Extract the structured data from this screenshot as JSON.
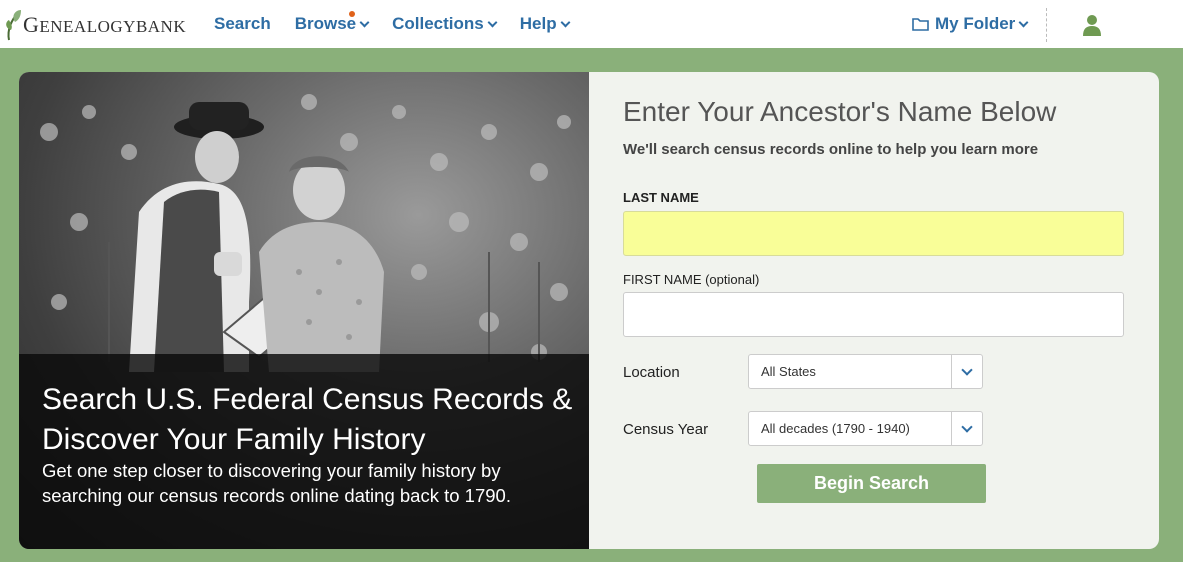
{
  "header": {
    "logo_text_initial": "G",
    "logo_text_rest": "ENEALOGY",
    "logo_text_bank": "BANK",
    "nav": [
      {
        "label": "Search"
      },
      {
        "label": "Browse"
      },
      {
        "label": "Collections"
      },
      {
        "label": "Help"
      }
    ],
    "folder_label": "My Folder"
  },
  "hero": {
    "title": "Search U.S. Federal Census Records & Discover Your Family History",
    "subtitle": "Get one step closer to discovering your family history by searching our census records online dating back to 1790."
  },
  "form": {
    "title": "Enter Your Ancestor's Name Below",
    "subtitle": "We'll search census records online to help you learn more",
    "last_name_label": "LAST NAME",
    "last_name_value": "",
    "first_name_label": "FIRST NAME (optional)",
    "first_name_value": "",
    "location_label": "Location",
    "location_value": "All States",
    "year_label": "Census Year",
    "year_value": "All decades (1790 - 1940)",
    "submit_label": "Begin Search"
  },
  "colors": {
    "brand_green": "#8ab07a",
    "link_blue": "#2e6da4",
    "last_name_highlight": "#f9fe98",
    "notification_dot": "#e0621a"
  },
  "icons": [
    "leaf-logo-icon",
    "chevron-down-icon",
    "folder-icon",
    "user-icon"
  ]
}
